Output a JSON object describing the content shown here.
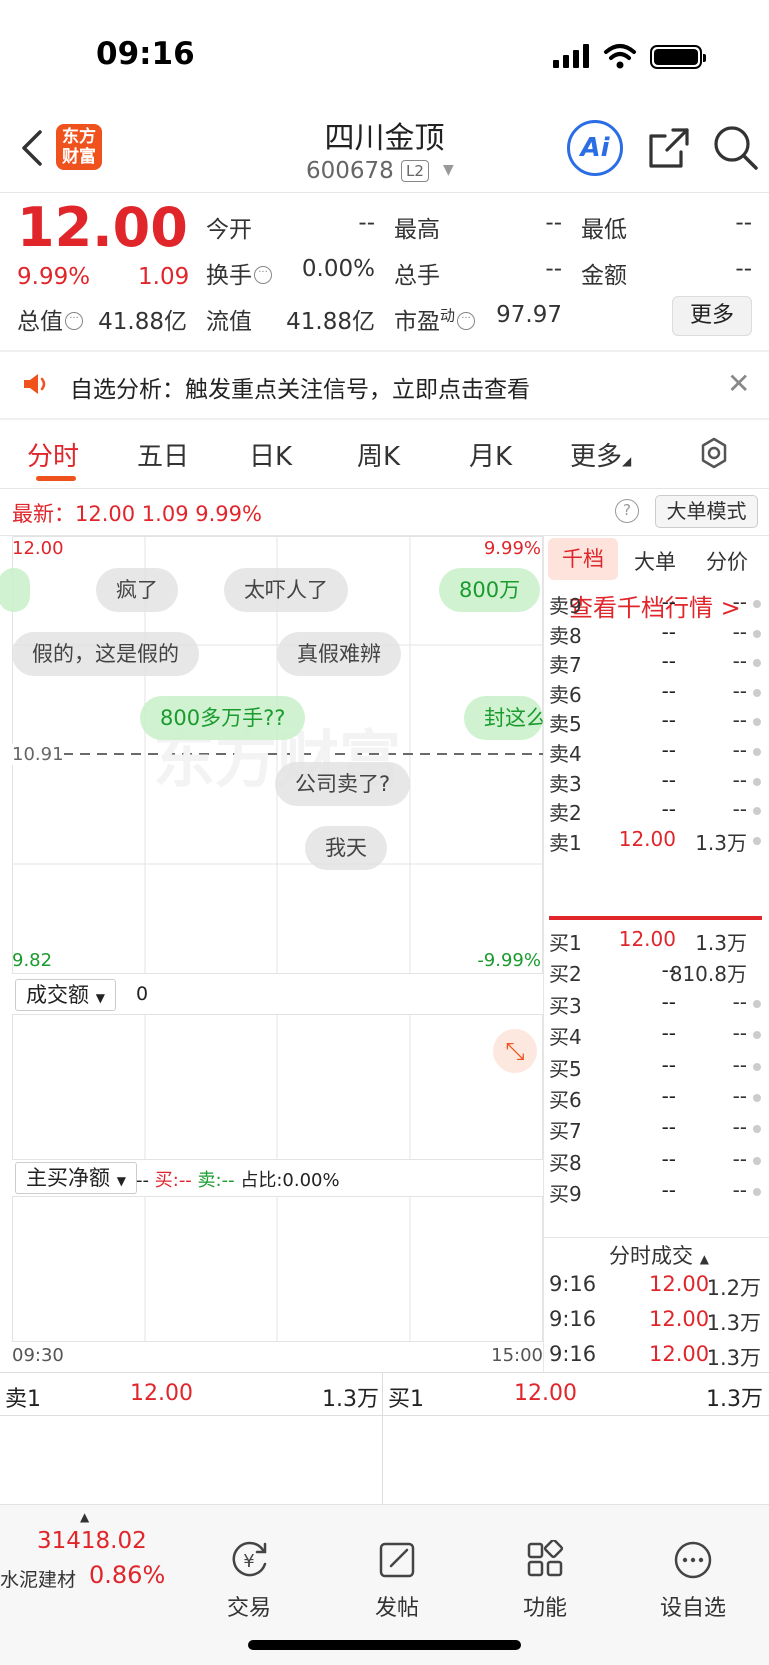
{
  "status_bar": {
    "time": "09:16"
  },
  "header": {
    "logo_line1": "东方",
    "logo_line2": "财富",
    "stock_name": "四川金顶",
    "stock_code": "600678",
    "level_badge": "L2",
    "ai_label": "Ai"
  },
  "quote": {
    "price": "12.00",
    "change_pct": "9.99%",
    "change_amt": "1.09",
    "labels": {
      "open": "今开",
      "high": "最高",
      "low": "最低",
      "turnover_rate": "换手",
      "volume": "总手",
      "amount": "金额",
      "mkt_cap": "总值",
      "float_cap": "流值",
      "pe": "市盈",
      "pe_sup": "动"
    },
    "open": "--",
    "high": "--",
    "low": "--",
    "turnover_rate": "0.00%",
    "volume": "--",
    "amount": "--",
    "mkt_cap": "41.88亿",
    "float_cap": "41.88亿",
    "pe": "97.97",
    "more_label": "更多"
  },
  "notice": {
    "text": "自选分析：触发重点关注信号，立即点击查看"
  },
  "tabs": [
    "分时",
    "五日",
    "日K",
    "周K",
    "月K",
    "更多"
  ],
  "latest": {
    "text": "最新：12.00  1.09  9.99%",
    "big_order_mode": "大单模式",
    "help": "?"
  },
  "chart": {
    "y_top": "12.00",
    "y_bottom": "9.82",
    "pct_top": "9.99%",
    "pct_bottom": "-9.99%",
    "mid_price": "10.91",
    "watermark": "东方财富",
    "time_start": "09:30",
    "time_end": "15:00",
    "colors": {
      "up": "#e0262b",
      "down": "#1a9b2e",
      "accent": "#f0521e"
    }
  },
  "danmaku": [
    {
      "text": "疯了",
      "green": false
    },
    {
      "text": "太吓人了",
      "green": false
    },
    {
      "text": "800万",
      "green": true
    },
    {
      "text": "假的，这是假的",
      "green": false
    },
    {
      "text": "真假难辨",
      "green": false
    },
    {
      "text": "800多万手??",
      "green": true
    },
    {
      "text": "封这么",
      "green": true
    },
    {
      "text": "公司卖了?",
      "green": false
    },
    {
      "text": "我天",
      "green": false
    }
  ],
  "volume_panel": {
    "selector": "成交额",
    "value": "0"
  },
  "flow_panel": {
    "selector": "主买净额",
    "dash": "--",
    "buy_label": "买:",
    "buy": "--",
    "sell_label": "卖:",
    "sell": "--",
    "ratio": "占比:0.00%"
  },
  "orderbook": {
    "tabs": [
      "千档",
      "大单",
      "分价"
    ],
    "link": "查看千档行情 >",
    "asks": [
      {
        "label": "卖9",
        "price": "--",
        "vol": "--"
      },
      {
        "label": "卖8",
        "price": "--",
        "vol": "--"
      },
      {
        "label": "卖7",
        "price": "--",
        "vol": "--"
      },
      {
        "label": "卖6",
        "price": "--",
        "vol": "--"
      },
      {
        "label": "卖5",
        "price": "--",
        "vol": "--"
      },
      {
        "label": "卖4",
        "price": "--",
        "vol": "--"
      },
      {
        "label": "卖3",
        "price": "--",
        "vol": "--"
      },
      {
        "label": "卖2",
        "price": "--",
        "vol": "--"
      },
      {
        "label": "卖1",
        "price": "12.00",
        "vol": "1.3万"
      }
    ],
    "bids": [
      {
        "label": "买1",
        "price": "12.00",
        "vol": "1.3万"
      },
      {
        "label": "买2",
        "price": "--",
        "vol": "810.8万"
      },
      {
        "label": "买3",
        "price": "--",
        "vol": "--"
      },
      {
        "label": "买4",
        "price": "--",
        "vol": "--"
      },
      {
        "label": "买5",
        "price": "--",
        "vol": "--"
      },
      {
        "label": "买6",
        "price": "--",
        "vol": "--"
      },
      {
        "label": "买7",
        "price": "--",
        "vol": "--"
      },
      {
        "label": "买8",
        "price": "--",
        "vol": "--"
      },
      {
        "label": "买9",
        "price": "--",
        "vol": "--"
      }
    ],
    "ticks_title": "分时成交",
    "ticks": [
      {
        "time": "9:16",
        "price": "12.00",
        "vol": "1.2万"
      },
      {
        "time": "9:16",
        "price": "12.00",
        "vol": "1.3万"
      },
      {
        "time": "9:16",
        "price": "12.00",
        "vol": "1.3万"
      }
    ]
  },
  "level_strip": {
    "ask_label": "卖1",
    "ask_price": "12.00",
    "ask_vol": "1.3万",
    "bid_label": "买1",
    "bid_price": "12.00",
    "bid_vol": "1.3万"
  },
  "tabbar": {
    "index_value": "31418.02",
    "index_name": "水泥建材",
    "index_change": "0.86%",
    "items": [
      "交易",
      "发帖",
      "功能",
      "设自选"
    ]
  }
}
